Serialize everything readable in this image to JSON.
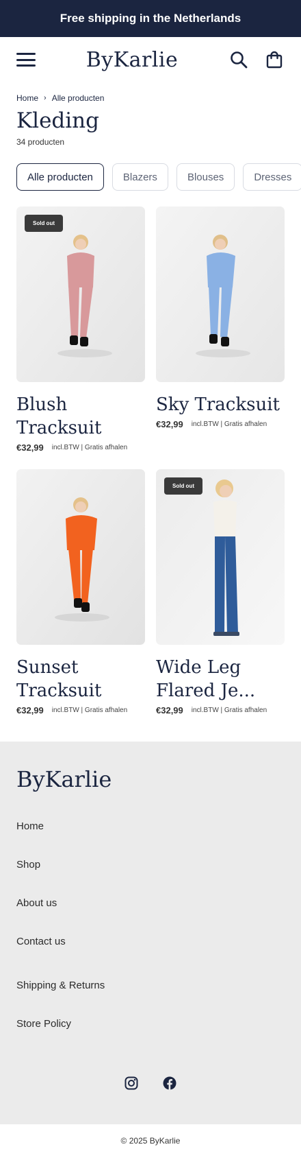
{
  "announcement": "Free shipping in the Netherlands",
  "header": {
    "logo": "ByKarlie",
    "icons": {
      "menu": "hamburger-menu-icon",
      "search": "search-icon",
      "cart": "shopping-bag-icon"
    }
  },
  "breadcrumb": {
    "home": "Home",
    "separator": "›",
    "current": "Alle producten"
  },
  "page": {
    "title": "Kleding",
    "count": "34 producten"
  },
  "filters": [
    "Alle producten",
    "Blazers",
    "Blouses",
    "Dresses"
  ],
  "products": [
    {
      "title": "Blush Tracksuit",
      "price": "€32,99",
      "meta": "incl.BTW | Gratis afhalen",
      "badge": "Sold out",
      "color": "#d8999b"
    },
    {
      "title": "Sky Tracksuit",
      "price": "€32,99",
      "meta": "incl.BTW | Gratis afhalen",
      "badge": "",
      "color": "#8ab1e4"
    },
    {
      "title": "Sunset Tracksuit",
      "price": "€32,99",
      "meta": "incl.BTW | Gratis afhalen",
      "badge": "",
      "color": "#f2621f"
    },
    {
      "title": "Wide Leg Flared Je...",
      "price": "€32,99",
      "meta": "incl.BTW | Gratis afhalen",
      "badge": "Sold out",
      "color": "#2f5c9a"
    }
  ],
  "footer": {
    "logo": "ByKarlie",
    "links": [
      "Home",
      "Shop",
      "About us",
      "Contact us",
      "Shipping & Returns",
      "Store Policy"
    ],
    "social": [
      "instagram-icon",
      "facebook-icon"
    ],
    "copyright": "© 2025 ByKarlie"
  },
  "colors": {
    "navy": "#1b2540",
    "footer_bg": "#ebebeb",
    "badge": "#3a3a3a"
  }
}
